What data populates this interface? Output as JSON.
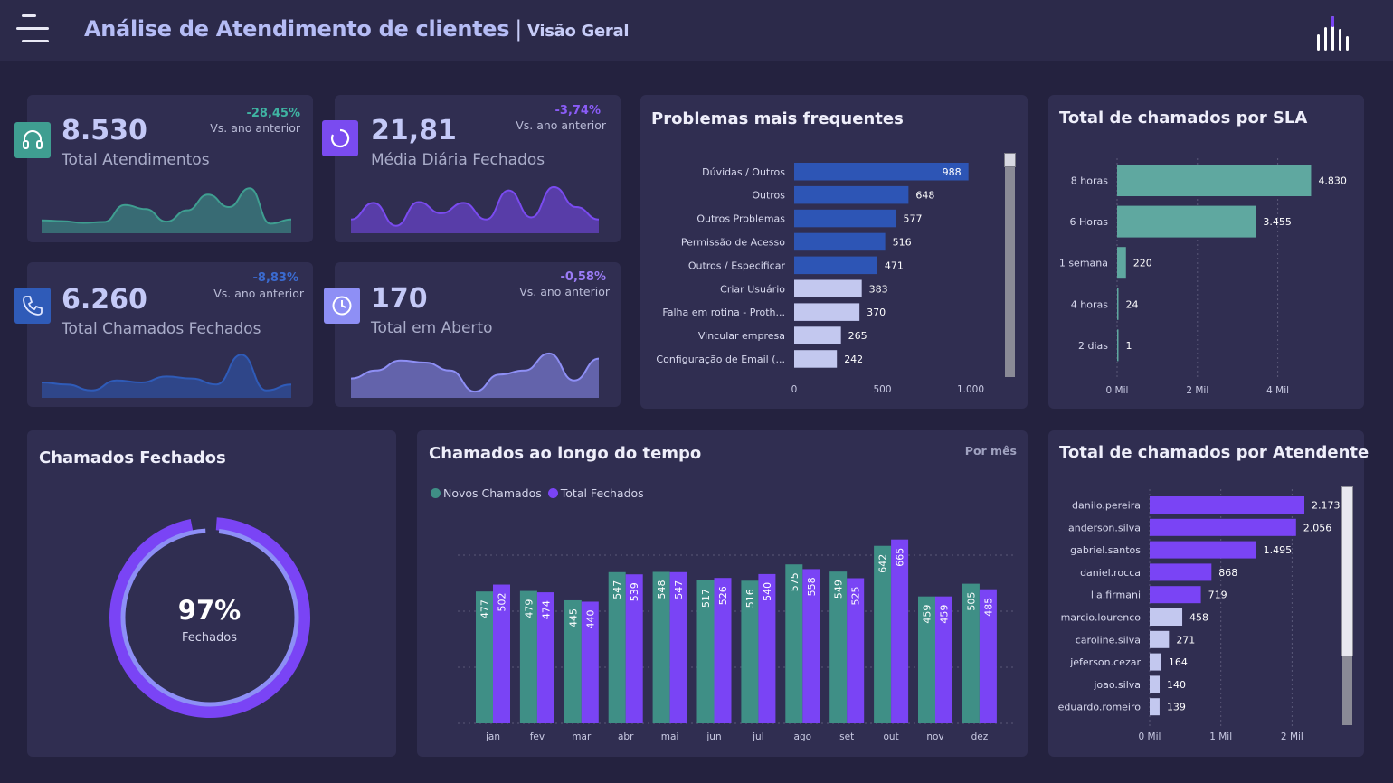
{
  "header": {
    "title": "Análise de Atendimento de clientes",
    "separator": "|",
    "subtitle": "Visão Geral",
    "menu_icon": "hamburger-menu-icon",
    "logo_icon": "bar-chart-logo-icon"
  },
  "kpis": [
    {
      "value": "8.530",
      "label": "Total Atendimentos",
      "delta": "-28,45%",
      "vs": "Vs. ano anterior",
      "icon": "headset-icon",
      "color": "#3f9e91",
      "spark": [
        0.18,
        0.16,
        0.12,
        0.14,
        0.55,
        0.45,
        0.15,
        0.42,
        0.8,
        0.5,
        0.95,
        0.1,
        0.2
      ]
    },
    {
      "value": "21,81",
      "label": "Média Diária Fechados",
      "delta": "-3,74%",
      "vs": "Vs. ano anterior",
      "icon": "refresh-circle-icon",
      "color": "#7a4bf0",
      "spark": [
        0.2,
        0.6,
        0.05,
        0.62,
        0.35,
        0.6,
        0.2,
        0.9,
        0.25,
        0.98,
        0.5,
        0.2
      ]
    },
    {
      "value": "6.260",
      "label": "Total Chamados Fechados",
      "delta": "-8,83%",
      "vs": "Vs. ano anterior",
      "icon": "phone-icon",
      "color": "#2f5bb8",
      "spark": [
        0.25,
        0.2,
        0.05,
        0.3,
        0.25,
        0.4,
        0.35,
        0.2,
        0.95,
        0.05,
        0.2
      ]
    },
    {
      "value": "170",
      "label": "Total em Aberto",
      "delta": "-0,58%",
      "vs": "Vs. ano anterior",
      "icon": "clock-icon",
      "color": "#8e8ff5",
      "spark": [
        0.35,
        0.55,
        0.8,
        0.75,
        0.55,
        0.02,
        0.45,
        0.55,
        0.98,
        0.3,
        0.85
      ]
    }
  ],
  "problems": {
    "title": "Problemas mais frequentes",
    "chart_data": {
      "type": "bar",
      "orientation": "horizontal",
      "categories": [
        "Dúvidas / Outros",
        "Outros",
        "Outros Problemas",
        "Permissão de Acesso",
        "Outros / Especificar",
        "Criar Usuário",
        "Falha em rotina - Proth...",
        "Vincular empresa",
        "Configuração de Email (..."
      ],
      "values": [
        988,
        648,
        577,
        516,
        471,
        383,
        370,
        265,
        242
      ],
      "value_labels": [
        "988",
        "648",
        "577",
        "516",
        "471",
        "383",
        "370",
        "265",
        "242"
      ],
      "highlight_colors": [
        "#2d55b5",
        "#2d55b5",
        "#2d55b5",
        "#2d55b5",
        "#2d55b5",
        "#c3c8ef",
        "#c3c8ef",
        "#c3c8ef",
        "#c3c8ef"
      ],
      "xlim": [
        0,
        1000
      ],
      "x_ticks": [
        "0",
        "500",
        "1.000"
      ]
    }
  },
  "sla": {
    "title": "Total de chamados por SLA",
    "chart_data": {
      "type": "bar",
      "orientation": "horizontal",
      "categories": [
        "8 horas",
        "6 Horas",
        "1 semana",
        "4 horas",
        "2 dias"
      ],
      "values": [
        4830,
        3455,
        220,
        24,
        1
      ],
      "value_labels": [
        "4.830",
        "3.455",
        "220",
        "24",
        "1"
      ],
      "color": "#5fa8a0",
      "xlim": [
        0,
        5000
      ],
      "x_ticks": [
        "0 Mil",
        "2 Mil",
        "4 Mil"
      ]
    }
  },
  "closed": {
    "title": "Chamados Fechados",
    "percent_text": "97%",
    "percent": 0.97,
    "label": "Fechados"
  },
  "timeline": {
    "title": "Chamados ao longo do tempo",
    "toggle": "Por mês",
    "legend": [
      {
        "name": "Novos Chamados",
        "color": "#3f8f86"
      },
      {
        "name": "Total Fechados",
        "color": "#7a44f5"
      }
    ],
    "chart_data": {
      "type": "bar",
      "categories": [
        "jan",
        "fev",
        "mar",
        "abr",
        "mai",
        "jun",
        "jul",
        "ago",
        "set",
        "out",
        "nov",
        "dez"
      ],
      "series": [
        {
          "name": "Novos Chamados",
          "values": [
            477,
            479,
            445,
            547,
            548,
            517,
            516,
            575,
            549,
            642,
            459,
            505
          ]
        },
        {
          "name": "Total Fechados",
          "values": [
            502,
            474,
            440,
            539,
            547,
            526,
            540,
            558,
            525,
            665,
            459,
            485
          ]
        }
      ]
    }
  },
  "agents": {
    "title": "Total de chamados por Atendente",
    "chart_data": {
      "type": "bar",
      "orientation": "horizontal",
      "categories": [
        "danilo.pereira",
        "anderson.silva",
        "gabriel.santos",
        "daniel.rocca",
        "lia.firmani",
        "marcio.lourenco",
        "caroline.silva",
        "jeferson.cezar",
        "joao.silva",
        "eduardo.romeiro"
      ],
      "values": [
        2173,
        2056,
        1495,
        868,
        719,
        458,
        271,
        164,
        140,
        139
      ],
      "value_labels": [
        "2.173",
        "2.056",
        "1.495",
        "868",
        "719",
        "458",
        "271",
        "164",
        "140",
        "139"
      ],
      "highlight_colors": [
        "#7a44f5",
        "#7a44f5",
        "#7a44f5",
        "#7a44f5",
        "#7a44f5",
        "#c3c8ef",
        "#c3c8ef",
        "#c3c8ef",
        "#c3c8ef",
        "#c3c8ef"
      ],
      "xlim": [
        0,
        2300
      ],
      "x_ticks": [
        "0 Mil",
        "1 Mil",
        "2 Mil"
      ]
    }
  }
}
